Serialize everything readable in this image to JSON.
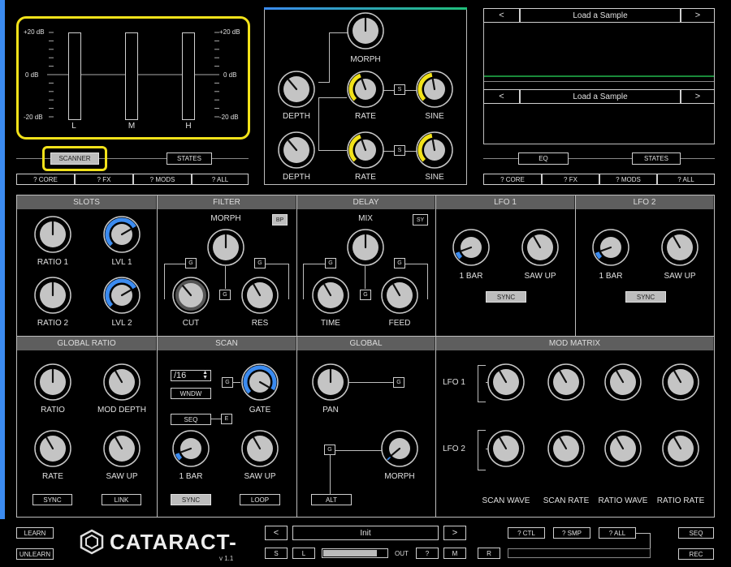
{
  "meters": {
    "db_top": "+20 dB",
    "db_mid": "0 dB",
    "db_bot": "-20 dB",
    "channels": [
      "L",
      "M",
      "H"
    ]
  },
  "top_left": {
    "scanner_label": "SCANNER",
    "states_label": "STATES",
    "help": [
      "? CORE",
      "? FX",
      "? MODS",
      "? ALL"
    ]
  },
  "top_mid": {
    "morph": "MORPH",
    "depth": "DEPTH",
    "rate": "RATE",
    "sine": "SINE",
    "s_label": "S"
  },
  "top_right": {
    "prev": "<",
    "next": ">",
    "sample1": "Load a Sample",
    "sample2": "Load a Sample",
    "eq": "EQ",
    "states": "STATES",
    "help": [
      "? CORE",
      "? FX",
      "? MODS",
      "? ALL"
    ]
  },
  "sections": {
    "slots": "SLOTS",
    "filter": "FILTER",
    "delay": "DELAY",
    "lfo1": "LFO 1",
    "lfo2": "LFO 2",
    "global_ratio": "GLOBAL RATIO",
    "scan": "SCAN",
    "global": "GLOBAL",
    "mod_matrix": "MOD MATRIX"
  },
  "slots": {
    "ratio1": "RATIO 1",
    "lvl1": "LVL 1",
    "ratio2": "RATIO 2",
    "lvl2": "LVL 2"
  },
  "filter": {
    "morph": "MORPH",
    "bp": "BP",
    "cut": "CUT",
    "res": "RES",
    "g": "G"
  },
  "delay": {
    "mix": "MIX",
    "sy": "SY",
    "time": "TIME",
    "feed": "FEED",
    "g": "G"
  },
  "lfo1": {
    "bar": "1 BAR",
    "saw": "SAW UP",
    "sync": "SYNC"
  },
  "lfo2": {
    "bar": "1 BAR",
    "saw": "SAW UP",
    "sync": "SYNC"
  },
  "global_ratio": {
    "ratio": "RATIO",
    "mod_depth": "MOD DEPTH",
    "rate": "RATE",
    "saw": "SAW UP",
    "sync": "SYNC",
    "link": "LINK"
  },
  "scan": {
    "division": "/16",
    "wndw": "WNDW",
    "seq": "SEQ",
    "e": "E",
    "g": "G",
    "gate": "GATE",
    "bar": "1 BAR",
    "saw": "SAW UP",
    "sync": "SYNC",
    "loop": "LOOP"
  },
  "global": {
    "pan": "PAN",
    "morph": "MORPH",
    "g": "G",
    "alt": "ALT"
  },
  "mod_matrix": {
    "lfo1": "LFO 1",
    "lfo2": "LFO 2",
    "cols": [
      "SCAN WAVE",
      "SCAN RATE",
      "RATIO WAVE",
      "RATIO RATE"
    ]
  },
  "footer": {
    "learn": "LEARN",
    "unlearn": "UNLEARN",
    "brand": "CATARACT",
    "version": "v 1.1",
    "prev": "<",
    "next": ">",
    "preset": "Init",
    "s": "S",
    "l": "L",
    "out": "OUT",
    "q": "?",
    "m": "M",
    "r": "R",
    "ctl": "? CTL",
    "smp": "? SMP",
    "all": "? ALL",
    "seq": "SEQ",
    "rec": "REC"
  },
  "colors": {
    "accent_blue": "#3b8bf0",
    "accent_yellow": "#f2e21a",
    "header_gray": "#5e5e5e",
    "knob_gray": "#c4c4c4",
    "wave_green": "#1a8a3a"
  }
}
